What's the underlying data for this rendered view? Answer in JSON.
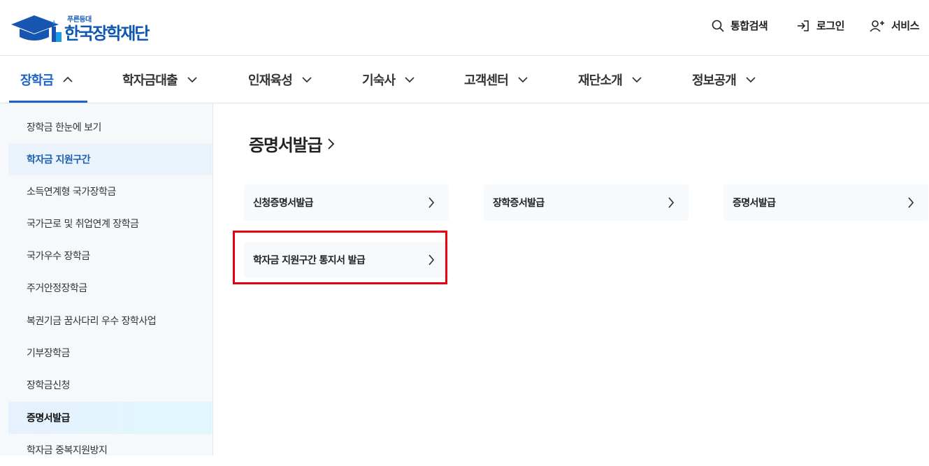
{
  "header": {
    "logo_small": "푸른등대",
    "logo_main": "한국장학재단",
    "utils": [
      {
        "label": "통합검색",
        "icon": "search-icon"
      },
      {
        "label": "로그인",
        "icon": "login-icon"
      },
      {
        "label": "서비스",
        "icon": "user-plus-icon"
      }
    ]
  },
  "gnb": {
    "items": [
      {
        "label": "장학금",
        "active": true
      },
      {
        "label": "학자금대출"
      },
      {
        "label": "인재육성"
      },
      {
        "label": "기숙사"
      },
      {
        "label": "고객센터"
      },
      {
        "label": "재단소개"
      },
      {
        "label": "정보공개"
      }
    ]
  },
  "sidebar": {
    "items": [
      {
        "label": "장학금 한눈에 보기"
      },
      {
        "label": "학자금 지원구간",
        "selected": true
      },
      {
        "label": "소득연계형 국가장학금"
      },
      {
        "label": "국가근로 및 취업연계 장학금"
      },
      {
        "label": "국가우수 장학금"
      },
      {
        "label": "주거안정장학금"
      },
      {
        "label": "복권기금 꿈사다리 우수 장학사업"
      },
      {
        "label": "기부장학금"
      },
      {
        "label": "장학금신청"
      },
      {
        "label": "증명서발급",
        "current": true
      },
      {
        "label": "학자금 중복지원방지"
      }
    ]
  },
  "main": {
    "title": "증명서발급",
    "cards": [
      {
        "label": "신청증명서발급"
      },
      {
        "label": "장학증서발급"
      },
      {
        "label": "증명서발급"
      },
      {
        "label": "학자금 지원구간 통지서 발급",
        "highlighted": true
      }
    ]
  },
  "colors": {
    "brand": "#0f57b3",
    "active_nav": "#1d63c9",
    "highlight_border": "#e60012"
  }
}
